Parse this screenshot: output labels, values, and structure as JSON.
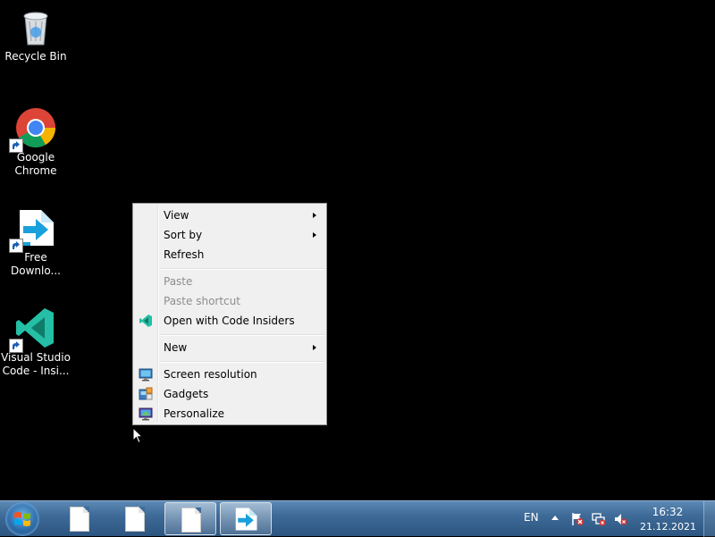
{
  "desktop": {
    "icons": [
      {
        "label": "Recycle Bin"
      },
      {
        "label_line1": "Google",
        "label_line2": "Chrome"
      },
      {
        "label_line1": "Free",
        "label_line2": "Downlo..."
      },
      {
        "label_line1": "Visual Studio",
        "label_line2": "Code - Insi..."
      }
    ]
  },
  "context_menu": {
    "items": [
      {
        "label": "View",
        "submenu": true,
        "enabled": true
      },
      {
        "label": "Sort by",
        "submenu": true,
        "enabled": true
      },
      {
        "label": "Refresh",
        "enabled": true
      },
      {
        "label": "Paste",
        "enabled": false
      },
      {
        "label": "Paste shortcut",
        "enabled": false
      },
      {
        "label": "Open with Code Insiders",
        "enabled": true,
        "icon": "vscode-insiders-icon"
      },
      {
        "label": "New",
        "submenu": true,
        "enabled": true
      },
      {
        "label": "Screen resolution",
        "enabled": true,
        "icon": "screen-resolution-icon"
      },
      {
        "label": "Gadgets",
        "enabled": true,
        "icon": "gadgets-icon"
      },
      {
        "label": "Personalize",
        "enabled": true,
        "icon": "personalize-icon"
      }
    ]
  },
  "taskbar": {
    "language": "EN",
    "clock": {
      "time": "16:32",
      "date": "21.12.2021"
    }
  },
  "colors": {
    "desktop_background": "#000000",
    "menu_background": "#f0f0f0",
    "disabled_text": "#8d8d8d",
    "vscode_insiders_teal": "#24bfa5",
    "taskbar_blue": "#3f6b98"
  }
}
